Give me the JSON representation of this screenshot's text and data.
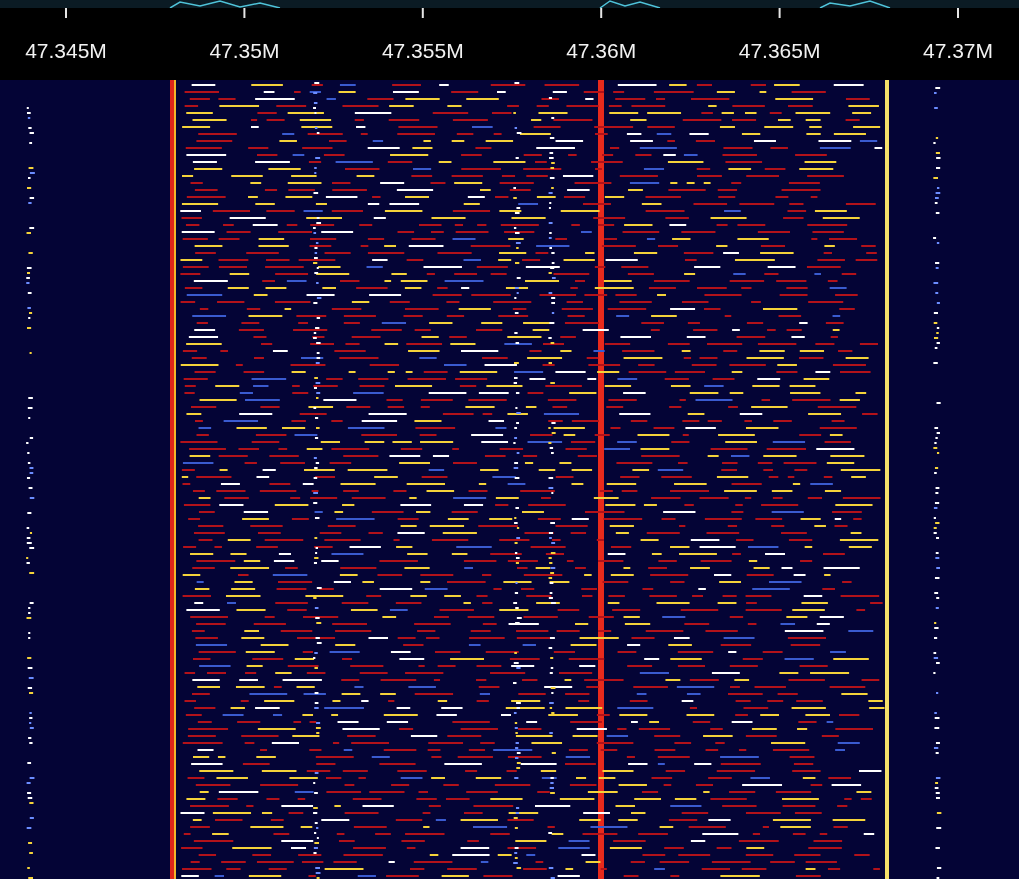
{
  "frequency_axis": {
    "labels": [
      "47.345M",
      "47.35M",
      "47.355M",
      "47.36M",
      "47.365M",
      "47.37M"
    ]
  }
}
